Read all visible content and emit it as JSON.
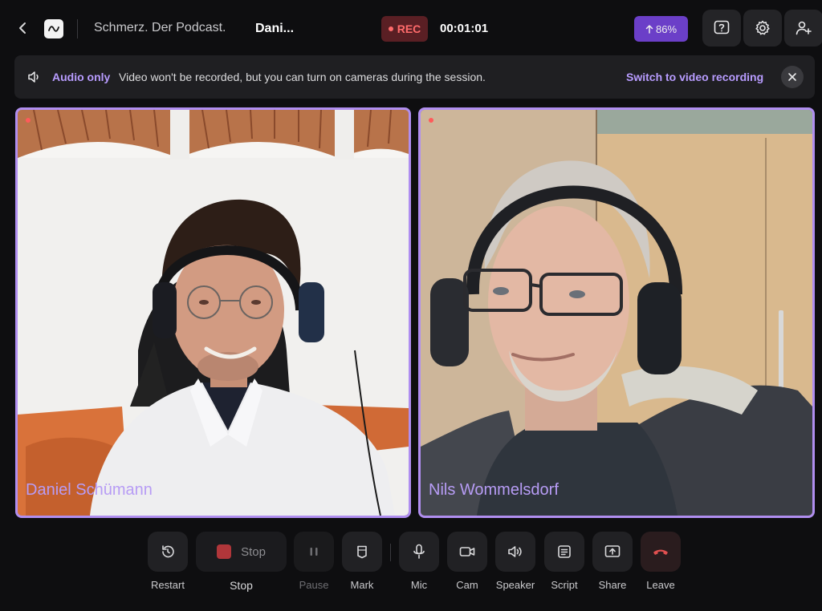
{
  "header": {
    "studio_name": "Schmerz. Der Podcast.",
    "session_title": "Dani...",
    "rec_label": "REC",
    "timer": "00:01:01",
    "upload_progress": "86%"
  },
  "banner": {
    "strong": "Audio only",
    "text": "Video won't be recorded, but you can turn on cameras during the session.",
    "link": "Switch to video recording"
  },
  "participants": [
    {
      "name": "Daniel Schümann"
    },
    {
      "name": "Nils Wommelsdorf"
    }
  ],
  "controls": {
    "restart": "Restart",
    "stop_button": "Stop",
    "stop": "Stop",
    "pause": "Pause",
    "mark": "Mark",
    "mic": "Mic",
    "cam": "Cam",
    "speaker": "Speaker",
    "script": "Script",
    "share": "Share",
    "leave": "Leave"
  },
  "colors": {
    "accent": "#b08ef0",
    "rec": "#ff6b6b",
    "leave": "#e05050",
    "background": "#0e0e10"
  },
  "icons": [
    "back-icon",
    "logo-icon",
    "upload-arrow-icon",
    "help-icon",
    "gear-icon",
    "add-user-icon",
    "speaker-icon",
    "close-icon",
    "restart-icon",
    "stop-icon",
    "pause-icon",
    "bookmark-icon",
    "mic-icon",
    "camera-icon",
    "speaker-icon",
    "script-icon",
    "share-icon",
    "phone-hangup-icon"
  ]
}
